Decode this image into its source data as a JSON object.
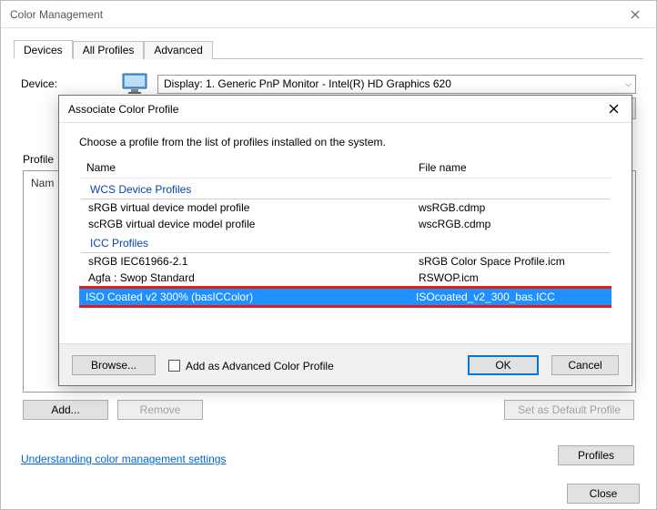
{
  "window": {
    "title": "Color Management",
    "tabs": [
      "Devices",
      "All Profiles",
      "Advanced"
    ],
    "device_label": "Device:",
    "device_selected": "Display: 1. Generic PnP Monitor - Intel(R) HD Graphics 620",
    "profiles_label": "Profile",
    "list_name_header": "Nam",
    "add_btn": "Add...",
    "remove_btn": "Remove",
    "set_default_btn": "Set as Default Profile",
    "link_text": "Understanding color management settings",
    "profiles_btn": "Profiles",
    "close_btn": "Close"
  },
  "modal": {
    "title": "Associate Color Profile",
    "subtitle": "Choose a profile from the list of profiles installed on the system.",
    "col_name": "Name",
    "col_file": "File name",
    "group_wcs": "WCS Device Profiles",
    "group_icc": "ICC Profiles",
    "rows": {
      "wcs1": {
        "name": "sRGB virtual device model profile",
        "file": "wsRGB.cdmp"
      },
      "wcs2": {
        "name": "scRGB virtual device model profile",
        "file": "wscRGB.cdmp"
      },
      "icc1": {
        "name": "sRGB IEC61966-2.1",
        "file": "sRGB Color Space Profile.icm"
      },
      "icc2": {
        "name": "Agfa : Swop Standard",
        "file": "RSWOP.icm"
      },
      "sel": {
        "name": "ISO Coated v2 300% (basICColor)",
        "file": "ISOcoated_v2_300_bas.ICC"
      }
    },
    "browse_btn": "Browse...",
    "add_adv_label": "Add as Advanced Color Profile",
    "ok_btn": "OK",
    "cancel_btn": "Cancel"
  }
}
